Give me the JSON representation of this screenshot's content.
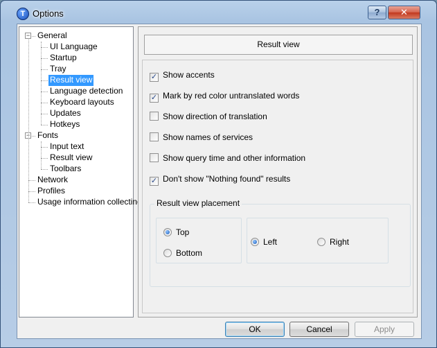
{
  "window": {
    "title": "Options",
    "help_label": "?",
    "close_label": "✕"
  },
  "tree": {
    "items": [
      {
        "label": "General",
        "level": 0,
        "expander": "−"
      },
      {
        "label": "UI Language",
        "level": 1
      },
      {
        "label": "Startup",
        "level": 1
      },
      {
        "label": "Tray",
        "level": 1
      },
      {
        "label": "Result view",
        "level": 1,
        "selected": true
      },
      {
        "label": "Language detection",
        "level": 1
      },
      {
        "label": "Keyboard layouts",
        "level": 1
      },
      {
        "label": "Updates",
        "level": 1
      },
      {
        "label": "Hotkeys",
        "level": 1
      },
      {
        "label": "Fonts",
        "level": 0,
        "expander": "−"
      },
      {
        "label": "Input text",
        "level": 1
      },
      {
        "label": "Result view",
        "level": 1
      },
      {
        "label": "Toolbars",
        "level": 1
      },
      {
        "label": "Network",
        "level": 0
      },
      {
        "label": "Profiles",
        "level": 0
      },
      {
        "label": "Usage information collecting",
        "level": 0
      }
    ]
  },
  "panel": {
    "header": "Result view",
    "checkboxes": [
      {
        "label": "Show accents",
        "checked": true
      },
      {
        "label": "Mark by red color untranslated words",
        "checked": true
      },
      {
        "label": "Show direction of translation",
        "checked": false
      },
      {
        "label": "Show names of services",
        "checked": false
      },
      {
        "label": "Show query time and other information",
        "checked": false
      },
      {
        "label": "Don't show \"Nothing found\" results",
        "checked": true
      }
    ],
    "placement": {
      "title": "Result view placement",
      "vertical": [
        {
          "label": "Top",
          "selected": true
        },
        {
          "label": "Bottom",
          "selected": false
        }
      ],
      "horizontal": [
        {
          "label": "Left",
          "selected": true
        },
        {
          "label": "Right",
          "selected": false
        }
      ]
    }
  },
  "buttons": {
    "ok": "OK",
    "cancel": "Cancel",
    "apply": "Apply"
  },
  "check_mark": "✓",
  "colors": {
    "selection": "#3399ff",
    "titlebar": "#b9d1ea",
    "close": "#c2381e"
  }
}
